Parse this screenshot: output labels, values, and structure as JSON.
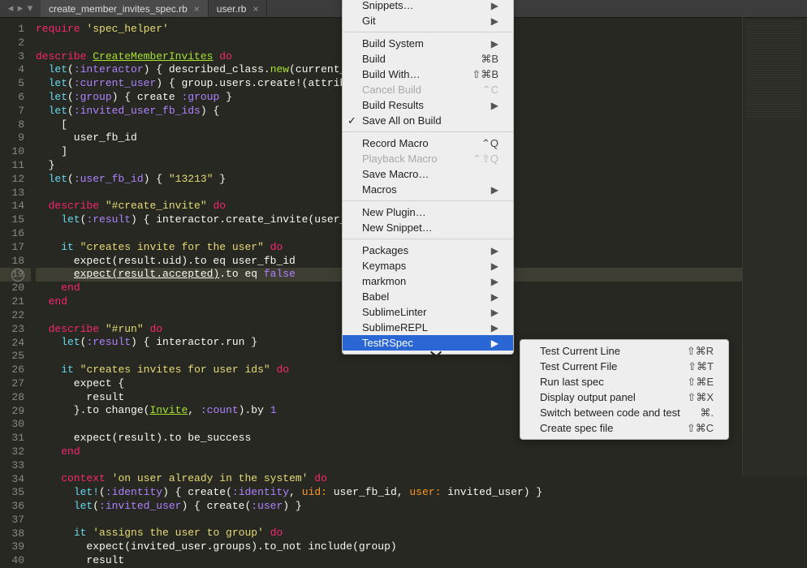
{
  "tabs": {
    "active": "create_member_invites_spec.rb",
    "other": "user.rb"
  },
  "code_lines": [
    "<span class='k1'>require</span> <span class='str'>'spec_helper'</span>",
    "",
    "<span class='k1'>describe</span> <span class='cls'>CreateMemberInvites</span> <span class='k1'>do</span>",
    "  <span class='fn'>let</span>(<span class='sym'>:interactor</span>) { described_class.<span class='def'>new</span>(current_user,",
    "  <span class='fn'>let</span>(<span class='sym'>:current_user</span>) { group.users.create!(attributes_",
    "  <span class='fn'>let</span>(<span class='sym'>:group</span>) { create <span class='sym'>:group</span> }",
    "  <span class='fn'>let</span>(<span class='sym'>:invited_user_fb_ids</span>) {",
    "    [",
    "      user_fb_id",
    "    ]",
    "  }",
    "  <span class='fn'>let</span>(<span class='sym'>:user_fb_id</span>) { <span class='str'>\"13213\"</span> }",
    "",
    "  <span class='k1'>describe</span> <span class='str'>\"#create_invite\"</span> <span class='k1'>do</span>",
    "    <span class='fn'>let</span>(<span class='sym'>:result</span>) { interactor.create_invite(user_fb_id",
    "",
    "    <span class='fn'>it</span> <span class='str'>\"creates invite for the user\"</span> <span class='k1'>do</span>",
    "      expect(result.uid).to eq user_fb_id",
    "      <span class='underline'>expect(result.accepted)</span>.to eq <span class='c-false'>false</span>",
    "    <span class='k1'>end</span>",
    "  <span class='k1'>end</span>",
    "",
    "  <span class='k1'>describe</span> <span class='str'>\"#run\"</span> <span class='k1'>do</span>",
    "    <span class='fn'>let</span>(<span class='sym'>:result</span>) { interactor.run }",
    "",
    "    <span class='fn'>it</span> <span class='str'>\"creates invites for user ids\"</span> <span class='k1'>do</span>",
    "      expect {",
    "        result",
    "      }.to change(<span class='cls'>Invite</span>, <span class='sym'>:count</span>).by <span class='sym'>1</span>",
    "",
    "      expect(result).to be_success",
    "    <span class='k1'>end</span>",
    "",
    "    <span class='k1'>context</span> <span class='str'>'on user already in the system'</span> <span class='k1'>do</span>",
    "      <span class='fn'>let!</span>(<span class='sym'>:identity</span>) { create(<span class='sym'>:identity</span>, <span class='sym2'>uid:</span> user_fb_id, <span class='sym2'>user:</span> invited_user) }",
    "      <span class='fn'>let</span>(<span class='sym'>:invited_user</span>) { create(<span class='sym'>:user</span>) }",
    "",
    "      <span class='fn'>it</span> <span class='str'>'assigns the user to group'</span> <span class='k1'>do</span>",
    "        expect(invited_user.groups).to_not include(group)",
    "        result"
  ],
  "menu_main": {
    "items": [
      {
        "label": "Snippets…",
        "arrow": true
      },
      {
        "label": "Git",
        "arrow": true
      },
      {
        "sep": true
      },
      {
        "label": "Build System",
        "arrow": true
      },
      {
        "label": "Build",
        "shortcut": "⌘B"
      },
      {
        "label": "Build With…",
        "shortcut": "⇧⌘B"
      },
      {
        "label": "Cancel Build",
        "shortcut": "⌃C",
        "disabled": true
      },
      {
        "label": "Build Results",
        "arrow": true
      },
      {
        "label": "Save All on Build",
        "checked": true
      },
      {
        "sep": true
      },
      {
        "label": "Record Macro",
        "shortcut": "⌃Q"
      },
      {
        "label": "Playback Macro",
        "shortcut": "⌃⇧Q",
        "disabled": true
      },
      {
        "label": "Save Macro…"
      },
      {
        "label": "Macros",
        "arrow": true
      },
      {
        "sep": true
      },
      {
        "label": "New Plugin…"
      },
      {
        "label": "New Snippet…"
      },
      {
        "sep": true
      },
      {
        "label": "Packages",
        "arrow": true
      },
      {
        "label": "Keymaps",
        "arrow": true
      },
      {
        "label": "markmon",
        "arrow": true
      },
      {
        "label": "Babel",
        "arrow": true
      },
      {
        "label": "SublimeLinter",
        "arrow": true
      },
      {
        "label": "SublimeREPL",
        "arrow": true
      },
      {
        "label": "TestRSpec",
        "arrow": true,
        "selected": true
      }
    ]
  },
  "menu_sub": {
    "items": [
      {
        "label": "Test Current Line",
        "shortcut": "⇧⌘R"
      },
      {
        "label": "Test Current File",
        "shortcut": "⇧⌘T"
      },
      {
        "label": "Run last spec",
        "shortcut": "⇧⌘E"
      },
      {
        "label": "Display output panel",
        "shortcut": "⇧⌘X"
      },
      {
        "label": "Switch between code and test",
        "shortcut": "⌘."
      },
      {
        "label": "Create spec file",
        "shortcut": "⇧⌘C"
      }
    ]
  }
}
